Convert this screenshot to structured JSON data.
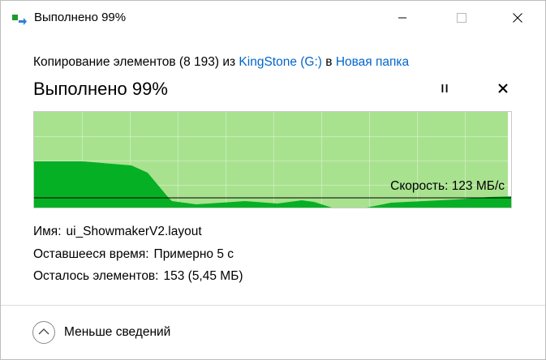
{
  "window": {
    "title": "Выполнено 99%"
  },
  "header": {
    "copy_prefix": "Копирование элементов (8 193) из ",
    "source_link": "KingStone (G:)",
    "copy_middle": " в ",
    "destination_link": "Новая папка",
    "progress_title": "Выполнено 99%"
  },
  "graph": {
    "speed_label": "Скорость: 123 МБ/с",
    "progress_fraction": 0.99,
    "colors": {
      "progress_fill": "#a8e28f",
      "history_fill": "#06b025",
      "grid": "#ffffff",
      "speed_line": "#000000"
    }
  },
  "details": {
    "name_label": "Имя:",
    "name_value": "ui_ShowmakerV2.layout",
    "time_label": "Оставшееся время:",
    "time_value": "Примерно 5 с",
    "items_label": "Осталось элементов:",
    "items_value": "153 (5,45 МБ)"
  },
  "footer": {
    "less_details_label": "Меньше сведений"
  },
  "icons": {
    "app": "copy-icon",
    "minimize": "minimize-icon",
    "maximize": "maximize-icon",
    "close": "close-icon",
    "pause": "pause-icon",
    "cancel": "cancel-icon",
    "chevron": "chevron-up-icon"
  }
}
